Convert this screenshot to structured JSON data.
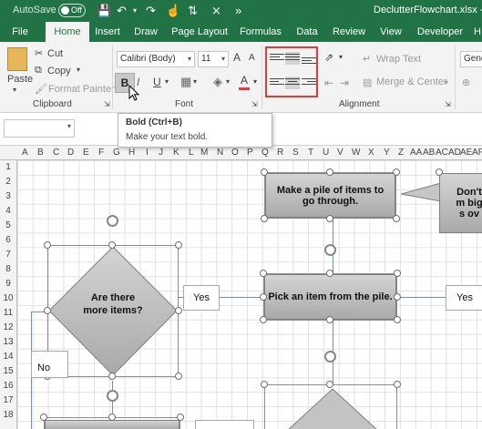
{
  "titlebar": {
    "autosave_label": "AutoSave",
    "autosave_state": "Off",
    "filename": "DeclutterFlowchart.xlsx - E"
  },
  "tabs": [
    "File",
    "Home",
    "Insert",
    "Draw",
    "Page Layout",
    "Formulas",
    "Data",
    "Review",
    "View",
    "Developer",
    "H"
  ],
  "ribbon": {
    "clipboard": {
      "paste": "Paste",
      "cut": "Cut",
      "copy": "Copy",
      "format_painter": "Format Painter",
      "label": "Clipboard"
    },
    "font": {
      "font_name": "Calibri (Body)",
      "font_size": "11",
      "grow": "A",
      "shrink": "A",
      "bold": "B",
      "italic": "I",
      "underline": "U",
      "font_color_letter": "A",
      "label": "Font"
    },
    "alignment": {
      "wrap_text": "Wrap Text",
      "merge_center": "Merge & Center",
      "label": "Alignment"
    },
    "number": {
      "format": "Genera"
    }
  },
  "tooltip": {
    "title": "Bold (Ctrl+B)",
    "description": "Make your text bold."
  },
  "grid": {
    "columns": [
      "A",
      "B",
      "C",
      "D",
      "E",
      "F",
      "G",
      "H",
      "I",
      "J",
      "K",
      "L",
      "M",
      "N",
      "O",
      "P",
      "Q",
      "R",
      "S",
      "T",
      "U",
      "V",
      "W",
      "X",
      "Y",
      "Z",
      "AA",
      "AB",
      "AC",
      "AD",
      "AE",
      "AF"
    ],
    "rows": [
      "1",
      "2",
      "3",
      "4",
      "5",
      "6",
      "7",
      "8",
      "9",
      "10",
      "11",
      "12",
      "13",
      "14",
      "15",
      "16",
      "17",
      "18"
    ]
  },
  "shapes": {
    "pile": "Make a pile of items to go through.",
    "pick": "Pick an item from the pile.",
    "are_there": "Are there more items?",
    "partial": "Don't m big s ov",
    "yes_left": "Yes",
    "yes_right": "Yes",
    "no": "No"
  },
  "colors": {
    "accent": "#217346",
    "highlight_box": "#e03c3c",
    "connector": "#6d8fc7"
  }
}
